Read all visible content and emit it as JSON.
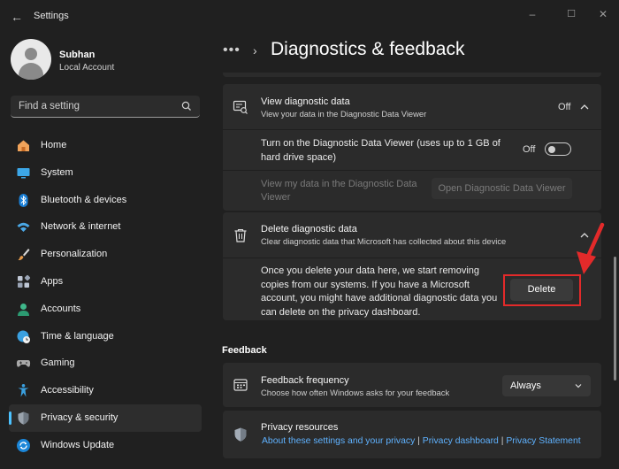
{
  "window": {
    "title": "Settings",
    "back_glyph": "←",
    "min_glyph": "–",
    "max_glyph": "☐",
    "close_glyph": "✕"
  },
  "profile": {
    "name": "Subhan",
    "account_type": "Local Account"
  },
  "search": {
    "placeholder": "Find a setting"
  },
  "sidebar": {
    "items": [
      {
        "label": "Home",
        "icon": "home-icon"
      },
      {
        "label": "System",
        "icon": "display-icon"
      },
      {
        "label": "Bluetooth & devices",
        "icon": "bluetooth-icon"
      },
      {
        "label": "Network & internet",
        "icon": "wifi-icon"
      },
      {
        "label": "Personalization",
        "icon": "brush-icon"
      },
      {
        "label": "Apps",
        "icon": "apps-icon"
      },
      {
        "label": "Accounts",
        "icon": "person-icon"
      },
      {
        "label": "Time & language",
        "icon": "globe-clock-icon"
      },
      {
        "label": "Gaming",
        "icon": "gamepad-icon"
      },
      {
        "label": "Accessibility",
        "icon": "accessibility-icon"
      },
      {
        "label": "Privacy & security",
        "icon": "shield-icon",
        "active": true
      },
      {
        "label": "Windows Update",
        "icon": "update-icon"
      }
    ]
  },
  "header": {
    "dots": "•••",
    "chevron": "›",
    "title": "Diagnostics & feedback"
  },
  "view_diagnostic": {
    "title": "View diagnostic data",
    "subtitle": "View your data in the Diagnostic Data Viewer",
    "status": "Off",
    "viewer_toggle_label_line1": "Turn on the Diagnostic Data Viewer (uses up to 1 GB of",
    "viewer_toggle_label_line2": "hard drive space)",
    "viewer_toggle_status": "Off",
    "view_my_data_line1": "View my data in the Diagnostic Data",
    "view_my_data_line2": "Viewer",
    "open_viewer_button": "Open Diagnostic Data Viewer"
  },
  "delete_diagnostic": {
    "title": "Delete diagnostic data",
    "subtitle": "Clear diagnostic data that Microsoft has collected about this device",
    "body_line1": "Once you delete your data here, we start removing",
    "body_line2": "copies from our systems. If you have a Microsoft",
    "body_line3": "account, you might have additional diagnostic data you",
    "body_line4": "can delete on the privacy dashboard.",
    "delete_button": "Delete"
  },
  "feedback": {
    "section_title": "Feedback",
    "frequency_title": "Feedback frequency",
    "frequency_subtitle": "Choose how often Windows asks for your feedback",
    "frequency_value": "Always"
  },
  "privacy_resources": {
    "title": "Privacy resources",
    "link1": "About these settings and your privacy",
    "separator": "|",
    "link2": "Privacy dashboard",
    "link3": "Privacy Statement"
  },
  "colors": {
    "accent": "#4cc2ff",
    "highlight": "#e32a2a",
    "link": "#5fb2ff"
  }
}
